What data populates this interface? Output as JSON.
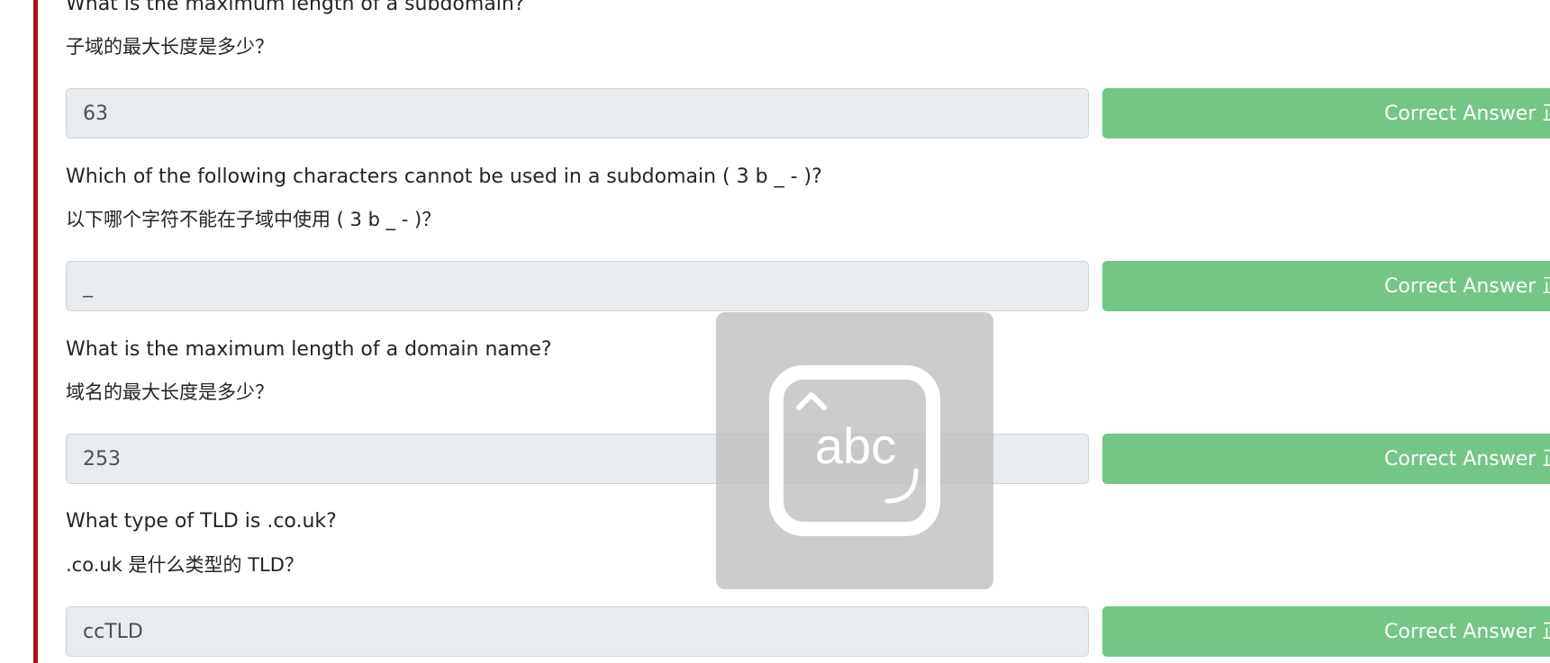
{
  "questions": [
    {
      "question_en": "What is the maximum length of a subdomain?",
      "question_zh": "子域的最大长度是多少？",
      "answer": "63",
      "button_label": "Correct Answer 正确答案"
    },
    {
      "question_en": "Which of the following characters cannot be used in a subdomain ( 3 b _ - )?",
      "question_zh": "以下哪个字符不能在子域中使用 ( 3 b _ - )？",
      "answer": "_",
      "button_label": "Correct Answer 正确答案"
    },
    {
      "question_en": "What is the maximum length of a domain name?",
      "question_zh": "域名的最大长度是多少？",
      "answer": "253",
      "button_label": "Correct Answer 正确答案"
    },
    {
      "question_en": "What type of TLD is .co.uk?",
      "question_zh": ".co.uk 是什么类型的 TLD？",
      "answer": "ccTLD",
      "button_label": "Correct Answer 正确答案"
    }
  ],
  "overlay": {
    "text": "abc",
    "icon": "keyboard-input-icon"
  },
  "colors": {
    "accent_bar": "#a31515",
    "button": "#74c686",
    "input_bg": "#e9ecef"
  }
}
